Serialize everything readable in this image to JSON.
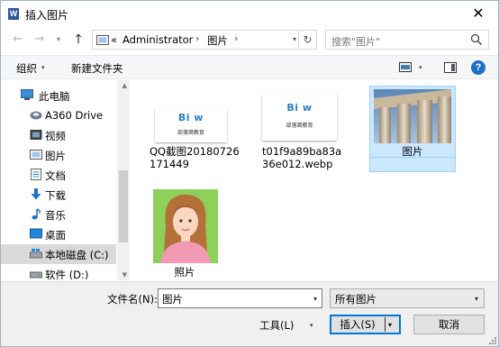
{
  "window": {
    "title": "插入图片",
    "app_icon_letter": "W",
    "close_glyph": "✕"
  },
  "nav": {
    "back_glyph": "←",
    "forward_glyph": "→",
    "recent_glyph": "▾",
    "up_glyph": "↑",
    "address_prefix": "«",
    "address_segments": [
      "Administrator",
      "图片"
    ],
    "address_chevron": "›",
    "refresh_glyph": "↻",
    "search_placeholder": "搜索\"图片\""
  },
  "toolbar": {
    "organize_label": "组织",
    "new_folder_label": "新建文件夹",
    "help_glyph": "?"
  },
  "sidebar": {
    "items": [
      {
        "label": "此电脑",
        "icon": "computer-icon"
      },
      {
        "label": "A360 Drive",
        "icon": "a360-drive-icon"
      },
      {
        "label": "视频",
        "icon": "video-folder-icon"
      },
      {
        "label": "图片",
        "icon": "pictures-folder-icon"
      },
      {
        "label": "文档",
        "icon": "documents-folder-icon"
      },
      {
        "label": "下载",
        "icon": "downloads-folder-icon"
      },
      {
        "label": "音乐",
        "icon": "music-folder-icon"
      },
      {
        "label": "桌面",
        "icon": "desktop-folder-icon"
      },
      {
        "label": "本地磁盘 (C:)",
        "icon": "drive-c-icon"
      },
      {
        "label": "软件 (D:)",
        "icon": "drive-d-icon"
      }
    ],
    "selected_index": 8
  },
  "files": [
    {
      "label": "QQ截图20180726171449",
      "type": "logo-image",
      "logo_mark": "Bi w",
      "logo_text": "部落窝教育"
    },
    {
      "label": "t01f9a89ba83a36e012.webp",
      "type": "logo-image",
      "logo_mark": "Bi w",
      "logo_text": "部落窝教育"
    },
    {
      "label": "图片",
      "type": "photo-columns",
      "selected": true
    },
    {
      "label": "照片",
      "type": "portrait"
    }
  ],
  "bottom": {
    "filename_label": "文件名(N):",
    "filename_value": "图片",
    "filetype_value": "所有图片",
    "tools_label": "工具(L)",
    "insert_label": "插入(S)",
    "cancel_label": "取消"
  },
  "colors": {
    "accent": "#0078d7",
    "selection_bg": "#cce8ff",
    "selection_border": "#99d1ff",
    "sidebar_selected": "#d9d9d9"
  }
}
